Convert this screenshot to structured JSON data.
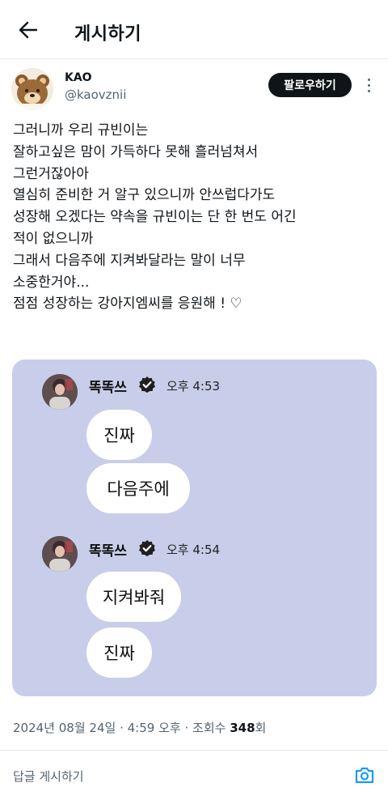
{
  "header": {
    "title": "게시하기"
  },
  "author": {
    "name": "KAO",
    "handle": "@kaovznii"
  },
  "actions": {
    "follow_label": "팔로우하기"
  },
  "tweet": {
    "lines": [
      "그러니까 우리 규빈이는",
      "잘하고싶은 맘이 가득하다 못해 흘러넘쳐서",
      "그런거잖아아",
      "열심히 준비한 거 알구 있으니까 안쓰럽다가도",
      "성장해 오겠다는 약속을 규빈이는 단 한 번도 어긴",
      "적이 없으니까",
      "그래서 다음주에 지켜봐달라는 말이 너무",
      "소중한거야...",
      "점점 성장하는 강아지엠씨를 응원해 ! ♡"
    ]
  },
  "chat": {
    "groups": [
      {
        "sender": "똑똑쓰",
        "time": "오후 4:53",
        "messages": [
          "진짜",
          "다음주에"
        ]
      },
      {
        "sender": "똑똑쓰",
        "time": "오후 4:54",
        "messages": [
          "지켜봐줘",
          "진짜"
        ]
      }
    ]
  },
  "meta": {
    "date": "2024년 08월 24일",
    "time": "4:59 오후",
    "views_label": "조회수",
    "views_count": "348",
    "views_suffix": "회"
  },
  "reply": {
    "placeholder": "답글 게시하기"
  },
  "colors": {
    "accent": "#1d9bf0",
    "chat_bg": "#c8cee9",
    "follow_bg": "#0f1419"
  }
}
